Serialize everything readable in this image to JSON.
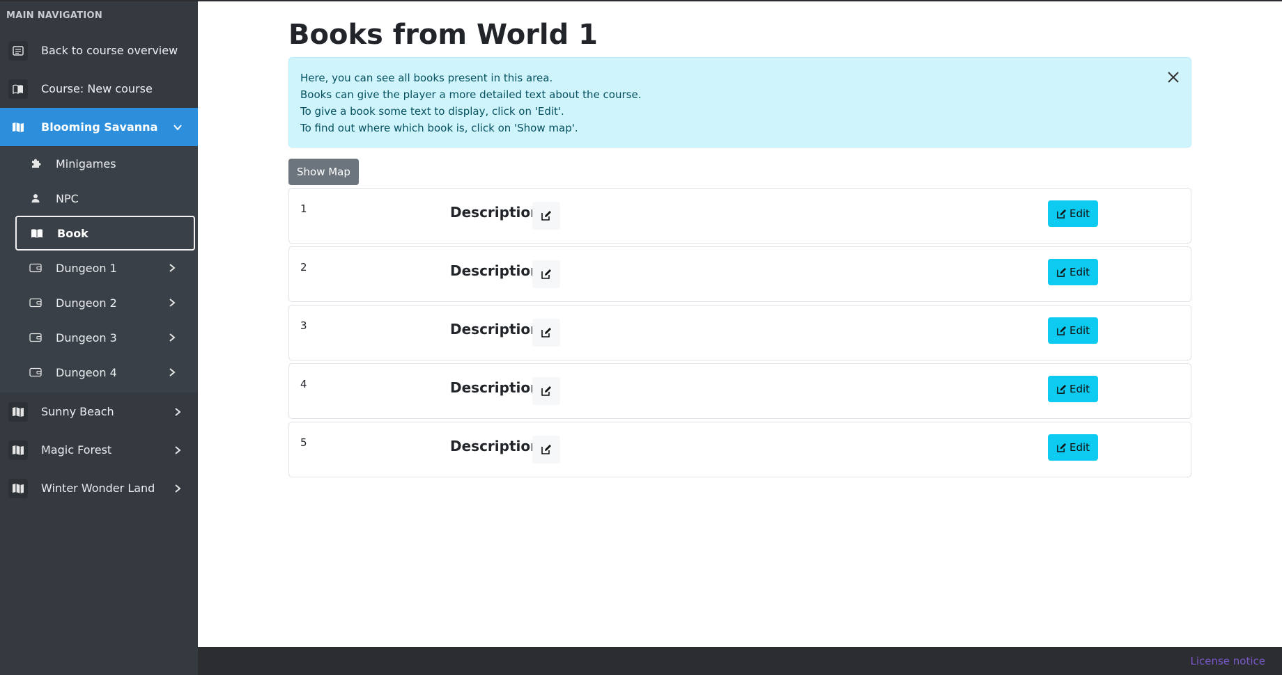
{
  "sidebar": {
    "header": "MAIN NAVIGATION",
    "back_label": "Back to course overview",
    "course_label": "Course: New course",
    "active_world": "Blooming Savanna",
    "sub_items": [
      {
        "label": "Minigames",
        "icon": "puzzle-icon"
      },
      {
        "label": "NPC",
        "icon": "person-icon"
      },
      {
        "label": "Book",
        "icon": "book-icon"
      },
      {
        "label": "Dungeon 1",
        "icon": "wallet-icon"
      },
      {
        "label": "Dungeon 2",
        "icon": "wallet-icon"
      },
      {
        "label": "Dungeon 3",
        "icon": "wallet-icon"
      },
      {
        "label": "Dungeon 4",
        "icon": "wallet-icon"
      }
    ],
    "worlds": [
      "Sunny Beach",
      "Magic Forest",
      "Winter Wonder Land"
    ]
  },
  "main": {
    "title": "Books from World 1",
    "alert_lines": [
      "Here, you can see all books present in this area.",
      "Books can give the player a more detailed text about the course.",
      "To give a book some text to display, click on 'Edit'.",
      "To find out where which book is, click on 'Show map'."
    ],
    "show_map_label": "Show Map",
    "description_label": "Description:",
    "edit_label": "Edit",
    "books": [
      "1",
      "2",
      "3",
      "4",
      "5"
    ]
  },
  "footer": {
    "license_label": "License notice"
  },
  "colors": {
    "sidebar_bg": "#343a40",
    "active_bg": "#2d8fdc",
    "alert_bg": "#cff4fc",
    "alert_text": "#055160",
    "edit_btn": "#0dcaf0",
    "show_map_btn": "#6c757d",
    "license_link": "#7b58c8"
  }
}
